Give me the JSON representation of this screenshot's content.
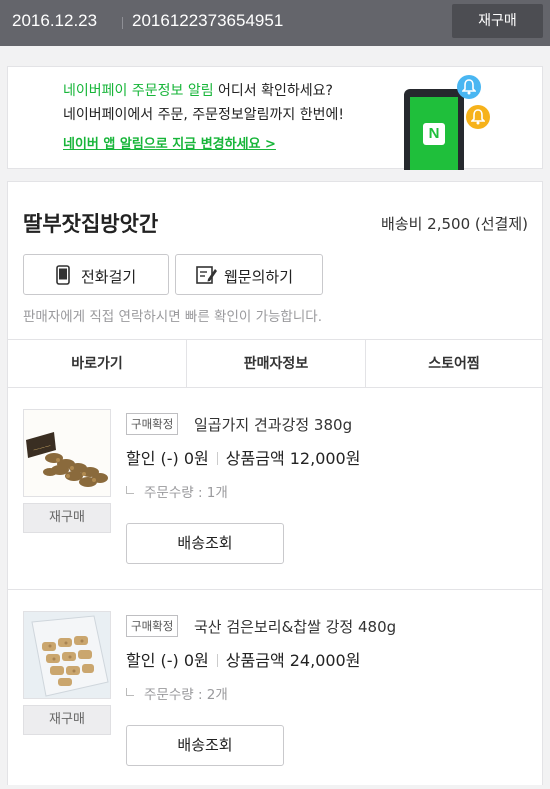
{
  "header": {
    "order_date": "2016.12.23",
    "order_number": "2016122373654951",
    "reorder_label": "재구매"
  },
  "banner": {
    "line1_highlight": "네이버페이 주문정보 알림",
    "line1_rest": " 어디서 확인하세요?",
    "line2": "네이버페이에서 주문, 주문정보알림까지 한번에!",
    "link_label": "네이버 앱 알림으로 지금 변경하세요 >",
    "logo_letter": "N"
  },
  "store": {
    "name": "딸부잣집방앗간",
    "shipping_fee": "배송비 2,500 (선결제)",
    "call_label": "전화걸기",
    "web_inquiry_label": "웹문의하기",
    "notice": "판매자에게 직접 연락하시면 빠른 확인이 가능합니다."
  },
  "tabs": [
    {
      "label": "바로가기"
    },
    {
      "label": "판매자정보"
    },
    {
      "label": "스토어찜"
    }
  ],
  "items": [
    {
      "status": "구매확정",
      "name": "일곱가지 견과강정 380g",
      "discount": "할인 (-) 0원",
      "price": "상품금액 12,000원",
      "quantity": "주문수량 : 1개",
      "reorder_label": "재구매",
      "track_label": "배송조회"
    },
    {
      "status": "구매확정",
      "name": "국산 검은보리&찹쌀 강정 480g",
      "discount": "할인 (-) 0원",
      "price": "상품금액 24,000원",
      "quantity": "주문수량 : 2개",
      "reorder_label": "재구매",
      "track_label": "배송조회"
    }
  ],
  "colors": {
    "naver_green": "#17b539",
    "header_bg": "#64656b"
  }
}
